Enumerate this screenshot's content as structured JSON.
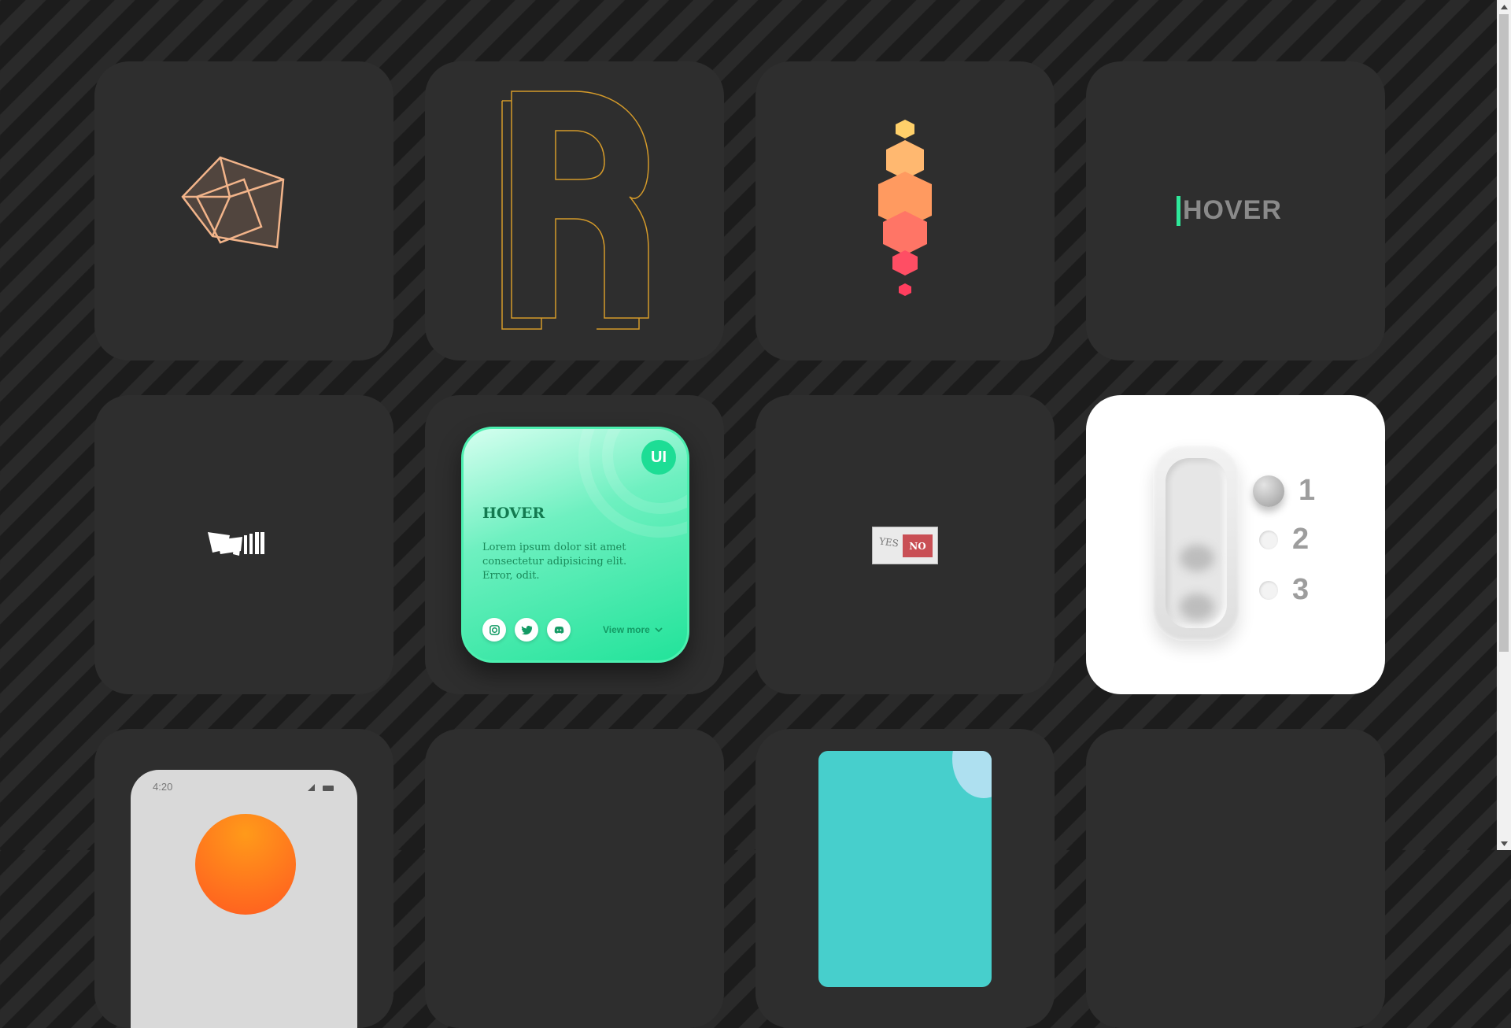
{
  "hover_card": {
    "label": "HOVER"
  },
  "social_card": {
    "logo": "UI",
    "title": "HOVER",
    "body": "Lorem ipsum dolor sit amet consectetur adipisicing elit. Error, odit.",
    "view_more": "View more",
    "icons": [
      "instagram-icon",
      "twitter-icon",
      "discord-icon"
    ]
  },
  "yes_no_toggle": {
    "yes": "YES",
    "no": "NO",
    "selected": "NO"
  },
  "neumorphic_switch": {
    "options": [
      "1",
      "2",
      "3"
    ],
    "selected": "1"
  },
  "phone": {
    "time": "4:20"
  },
  "colors": {
    "accent_green": "#2ee89a",
    "card_bg": "#2e2e2e",
    "letter_outline": "#d49a2a",
    "cube_outline": "#f2b48a",
    "no_red": "#c94f55",
    "teal": "#47cfcc",
    "sun_orange": "#ff7a1a"
  }
}
